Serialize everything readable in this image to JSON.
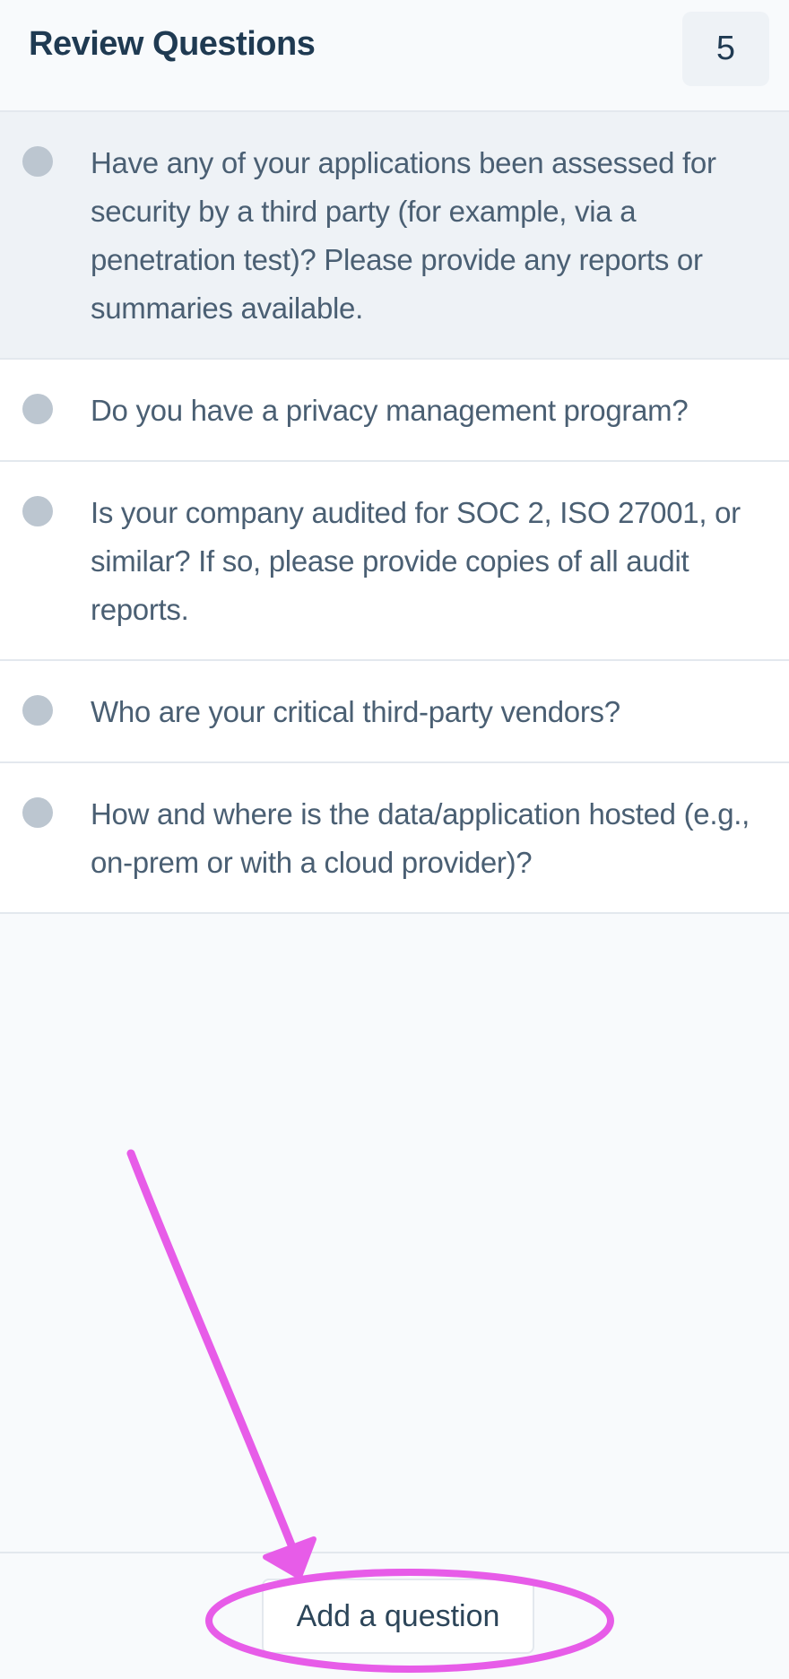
{
  "header": {
    "title": "Review Questions",
    "count": "5"
  },
  "questions": [
    {
      "text": "Have any of your applications been assessed for security by a third party (for example, via a penetration test)? Please provide any reports or summaries available.",
      "selected": true
    },
    {
      "text": "Do you have a privacy management program?",
      "selected": false
    },
    {
      "text": "Is your company audited for SOC 2, ISO 27001, or similar? If so, please provide copies of all audit reports.",
      "selected": false
    },
    {
      "text": "Who are your critical third-party vendors?",
      "selected": false
    },
    {
      "text": "How and where is the data/application hosted (e.g., on-prem or with a cloud provider)?",
      "selected": false
    }
  ],
  "footer": {
    "add_label": "Add a question"
  },
  "colors": {
    "annotation": "#e75ce8",
    "selected_row": "#eef2f6",
    "dot": "#bcc6d0",
    "title": "#1f3a52"
  }
}
